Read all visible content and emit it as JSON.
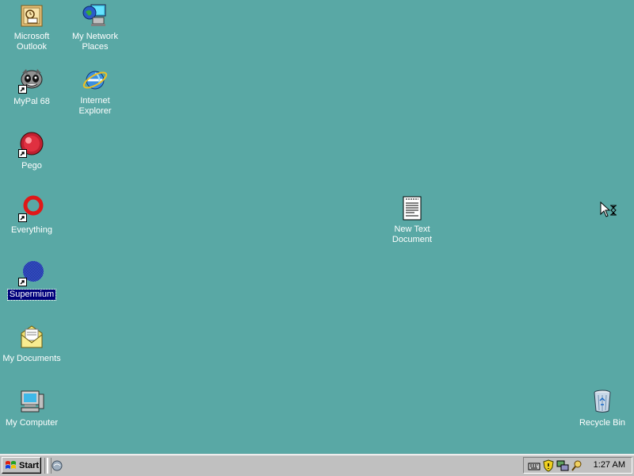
{
  "desktop": {
    "background_color": "#59a8a5",
    "icons": {
      "outlook": {
        "label": "Microsoft\nOutlook",
        "icon": "outlook-icon"
      },
      "network": {
        "label": "My Network\nPlaces",
        "icon": "network-places-icon"
      },
      "mypal": {
        "label": "MyPal 68",
        "icon": "mypal-icon"
      },
      "ie": {
        "label": "Internet\nExplorer",
        "icon": "internet-explorer-icon"
      },
      "pego": {
        "label": "Pego",
        "icon": "pego-icon"
      },
      "everything": {
        "label": "Everything",
        "icon": "everything-icon"
      },
      "newtext": {
        "label": "New Text\nDocument",
        "icon": "text-document-icon"
      },
      "supermium": {
        "label": "Supermium",
        "icon": "supermium-icon",
        "selected": true
      },
      "mydocs": {
        "label": "My Documents",
        "icon": "my-documents-icon"
      },
      "mycomputer": {
        "label": "My Computer",
        "icon": "my-computer-icon"
      },
      "recycle": {
        "label": "Recycle Bin",
        "icon": "recycle-bin-icon"
      }
    }
  },
  "taskbar": {
    "start_label": "Start",
    "clock": "1:27 AM"
  }
}
